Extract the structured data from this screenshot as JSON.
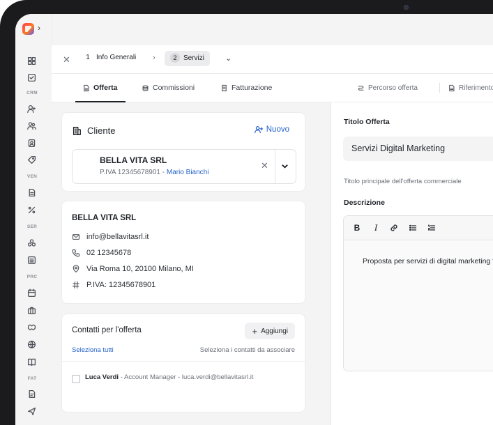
{
  "topbar": {
    "steps": [
      {
        "num": "1",
        "label": "Info Generali"
      },
      {
        "num": "2",
        "label": "Servizi"
      }
    ]
  },
  "tabs": {
    "left": [
      "Offerta",
      "Commissioni",
      "Fatturazione"
    ],
    "right": [
      "Percorso offerta",
      "Riferimento"
    ]
  },
  "sidebar": {
    "sections": [
      "CRM",
      "VEN",
      "SER",
      "PRC",
      "FAT"
    ]
  },
  "cliente": {
    "title": "Cliente",
    "new_label": "Nuovo",
    "selected": {
      "name": "BELLA VITA SRL",
      "piva": "P.IVA 12345678901",
      "separator": "-",
      "contact": "Mario Bianchi"
    }
  },
  "details": {
    "name": "BELLA VITA SRL",
    "email": "info@bellavitasrl.it",
    "phone": "02 12345678",
    "address": "Via Roma 10, 20100 Milano, MI",
    "piva": "P.IVA: 12345678901"
  },
  "contatti": {
    "title": "Contatti per l'offerta",
    "add_label": "Aggiungi",
    "select_all": "Seleziona tutti",
    "hint": "Seleziona i contatti da associare",
    "items": [
      {
        "name": "Luca Verdi",
        "role": "Account Manager",
        "email": "luca.verdi@bellavitasrl.it",
        "sep": "-"
      }
    ]
  },
  "offerta": {
    "title_label": "Titolo Offerta",
    "title_value": "Servizi Digital Marketing",
    "title_hint": "Titolo principale dell'offerta commerciale",
    "desc_label": "Descrizione",
    "desc_value": "Proposta per servizi di digital marketing fin"
  },
  "colors": {
    "accent": "#2563c9",
    "bezel": "#1b1b1d",
    "background": "#f4f4f5"
  }
}
